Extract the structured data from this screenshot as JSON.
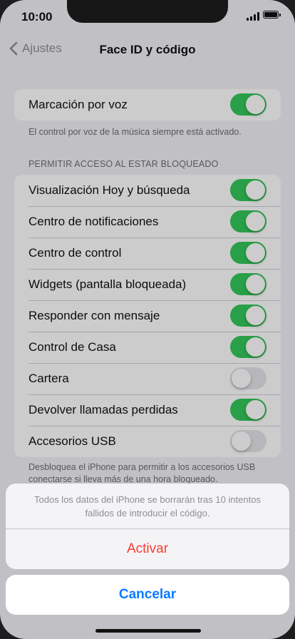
{
  "status": {
    "time": "10:00"
  },
  "nav": {
    "back_label": "Ajustes",
    "title": "Face ID y código"
  },
  "voice": {
    "label": "Marcación por voz",
    "on": true,
    "footnote": "El control por voz de la música siempre está activado."
  },
  "locked_access": {
    "header": "PERMITIR ACCESO AL ESTAR BLOQUEADO",
    "items": [
      {
        "label": "Visualización Hoy y búsqueda",
        "on": true
      },
      {
        "label": "Centro de notificaciones",
        "on": true
      },
      {
        "label": "Centro de control",
        "on": true
      },
      {
        "label": "Widgets (pantalla bloqueada)",
        "on": true
      },
      {
        "label": "Responder con mensaje",
        "on": true
      },
      {
        "label": "Control de Casa",
        "on": true
      },
      {
        "label": "Cartera",
        "on": false
      },
      {
        "label": "Devolver llamadas perdidas",
        "on": true
      },
      {
        "label": "Accesorios USB",
        "on": false
      }
    ],
    "footnote": "Desbloquea el iPhone para permitir a los accesorios USB conectarse si lleva más de una hora bloqueado."
  },
  "action_sheet": {
    "message": "Todos los datos del iPhone se borrarán tras 10 intentos fallidos de introducir el código.",
    "action_label": "Activar",
    "cancel_label": "Cancelar"
  },
  "colors": {
    "toggle_on": "#34c759",
    "toggle_off": "#e5e5ea",
    "destructive": "#ff3b30",
    "tint": "#0a7aff"
  }
}
